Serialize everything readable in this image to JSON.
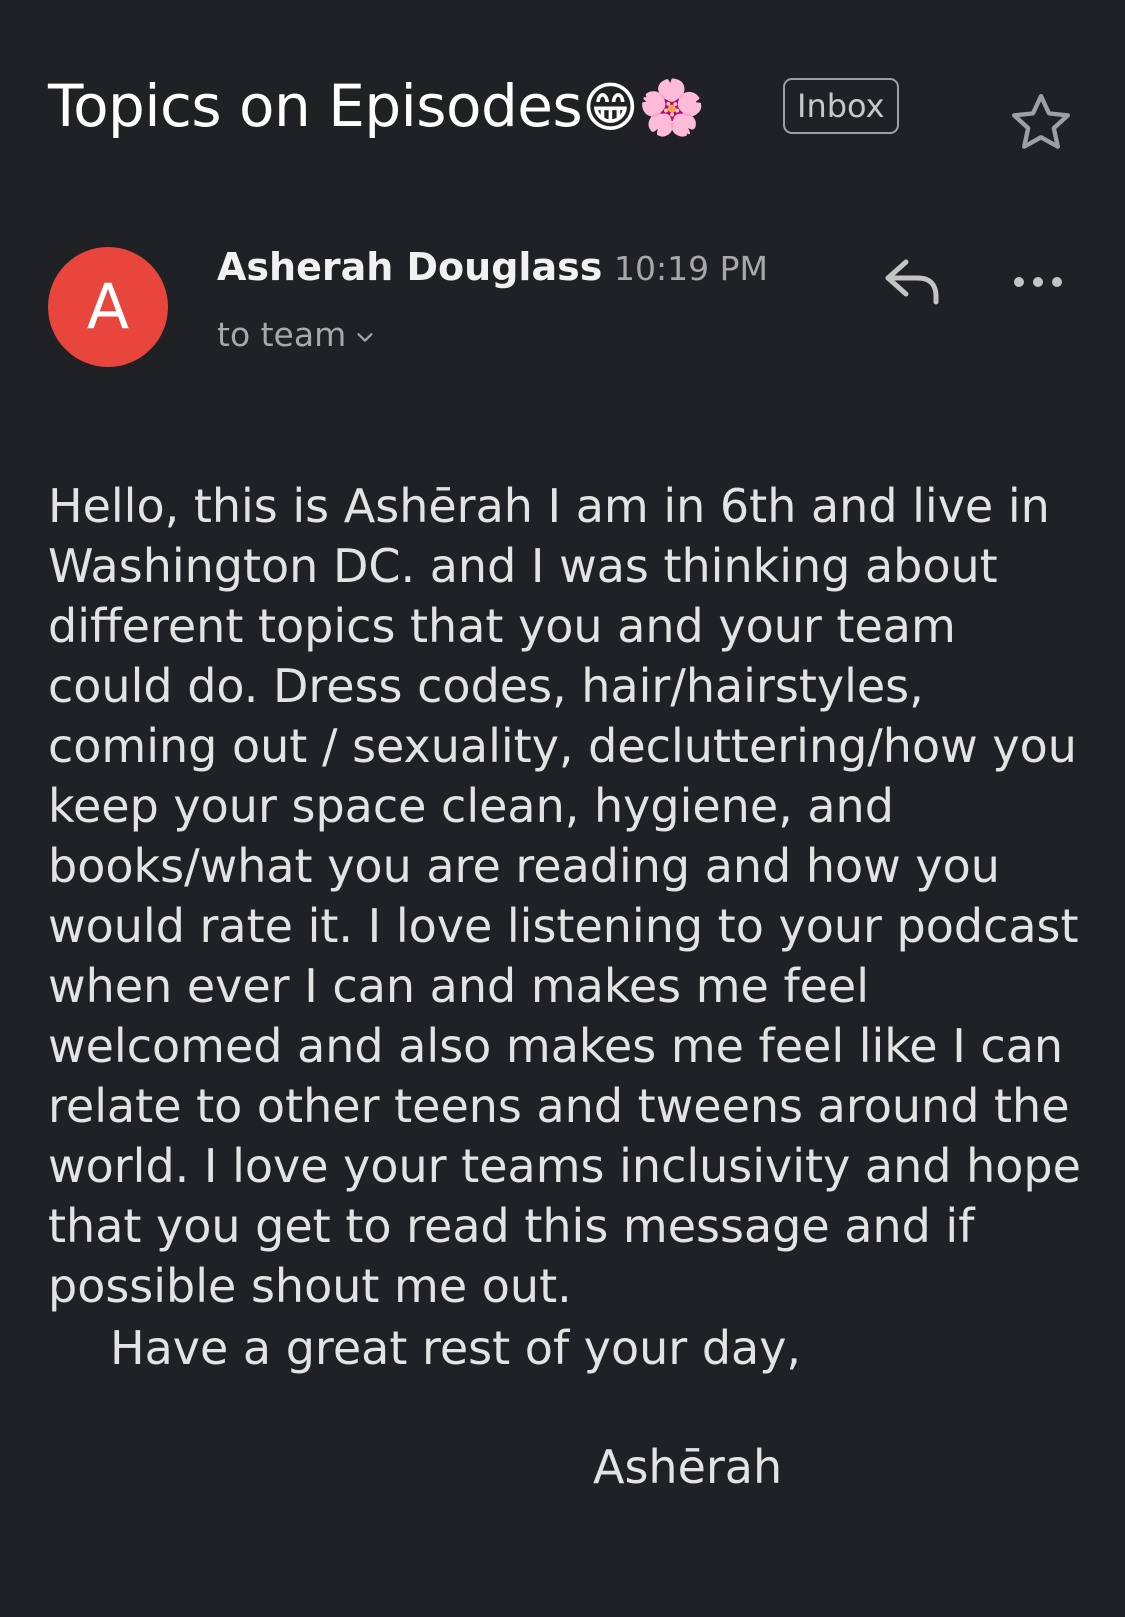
{
  "email": {
    "subject": "Topics on Episodes",
    "subject_emojis": "😁🌸",
    "label": "Inbox",
    "sender": {
      "name": "Asherah Douglass",
      "initial": "A",
      "avatar_color": "#e8453c"
    },
    "time": "10:19 PM",
    "recipients": "to team",
    "body": "Hello, this is Ashērah I am in 6th and live in Washington DC. and I was thinking about different topics that you and your team could do. Dress codes, hair/hairstyles, coming out / sexuality, decluttering/how you keep your space clean, hygiene, and books/what you are reading and how you would rate it. I love listening to your podcast when ever I can and makes me feel welcomed and also makes me feel like I can relate to other teens and tweens around the world. I love your teams inclusivity and hope that you get to read this message and if possible shout me out.",
    "closing": "Have a great rest of your day,",
    "signature": "Ashērah"
  },
  "icons": {
    "star": "star-outline-icon",
    "reply": "reply-icon",
    "more": "more-horizontal-icon",
    "chevron": "chevron-down-icon"
  },
  "colors": {
    "background": "#202124",
    "text": "#e3e3e3",
    "muted": "#a8a8a8"
  }
}
